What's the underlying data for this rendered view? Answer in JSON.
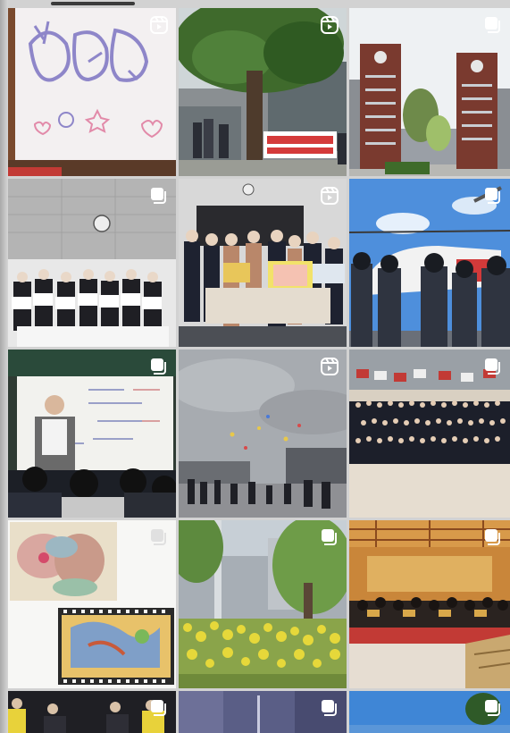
{
  "feed": {
    "posts": [
      {
        "media": "reel",
        "badge_icon": "reels-icon"
      },
      {
        "media": "reel",
        "badge_icon": "reels-icon"
      },
      {
        "media": "carousel",
        "badge_icon": "carousel-icon"
      },
      {
        "media": "carousel",
        "badge_icon": "carousel-icon"
      },
      {
        "media": "reel",
        "badge_icon": "reels-icon"
      },
      {
        "media": "carousel",
        "badge_icon": "carousel-icon"
      },
      {
        "media": "carousel",
        "badge_icon": "carousel-icon"
      },
      {
        "media": "reel",
        "badge_icon": "reels-icon"
      },
      {
        "media": "carousel",
        "badge_icon": "carousel-icon"
      },
      {
        "media": "carousel",
        "badge_icon": "carousel-icon"
      },
      {
        "media": "carousel",
        "badge_icon": "carousel-icon"
      },
      {
        "media": "carousel",
        "badge_icon": "carousel-icon"
      },
      {
        "media": "carousel",
        "badge_icon": "carousel-icon"
      },
      {
        "media": "carousel",
        "badge_icon": "carousel-icon"
      },
      {
        "media": "carousel",
        "badge_icon": "carousel-icon"
      }
    ]
  },
  "colors": {
    "gutter": "#d2d2d2",
    "badge": "#ffffff"
  }
}
